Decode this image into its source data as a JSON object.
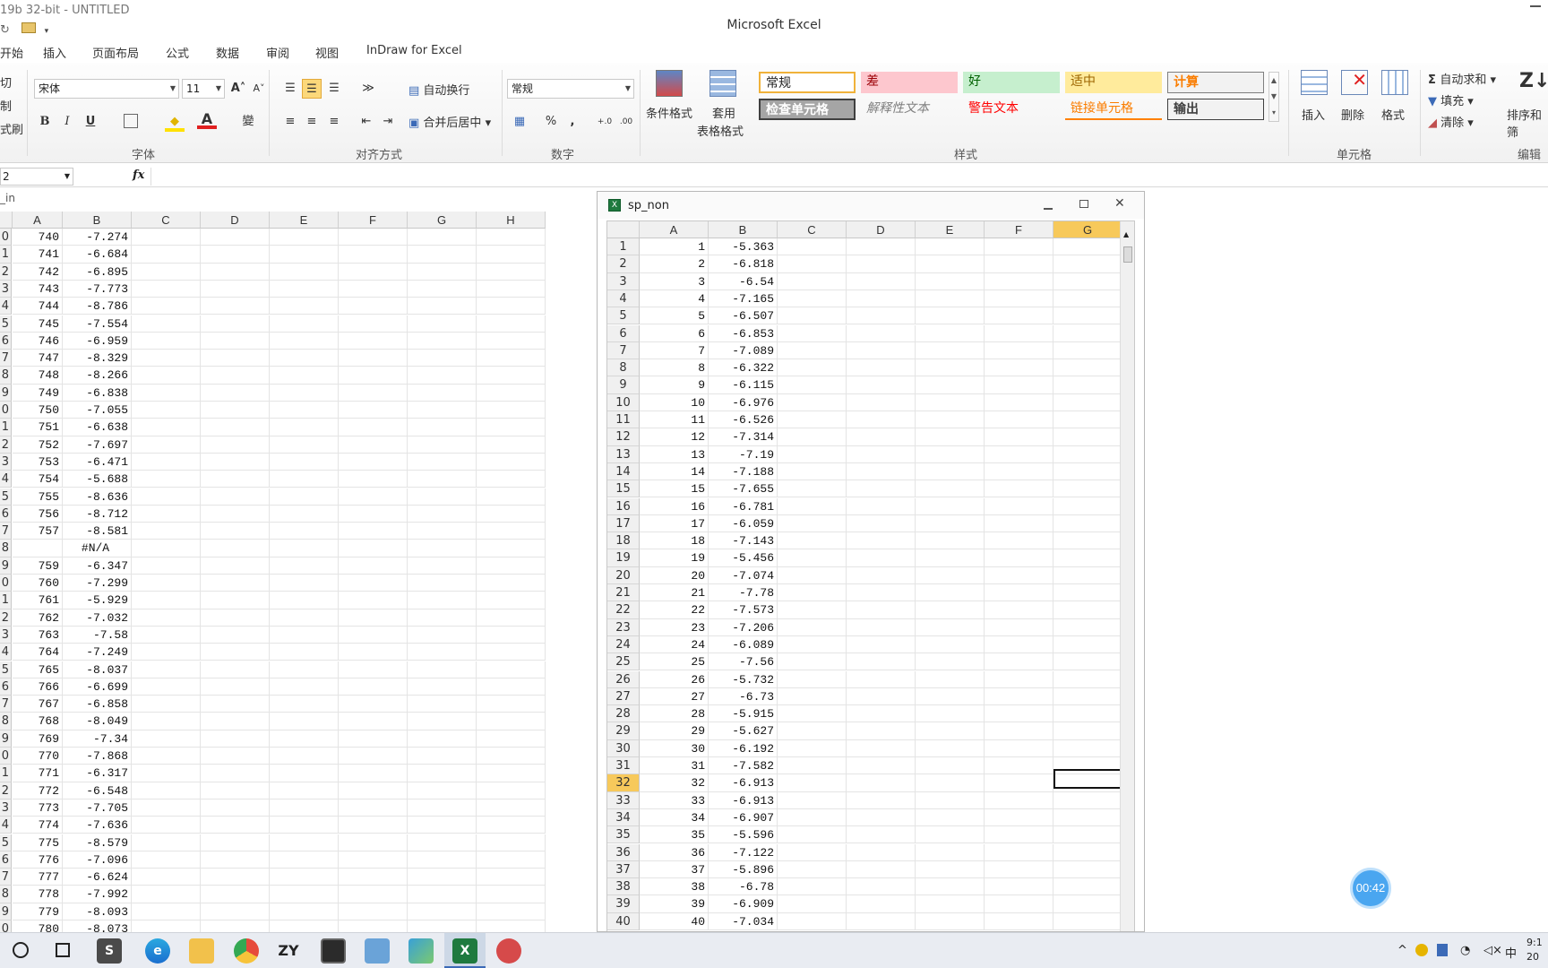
{
  "titlebar": {
    "background_title": "19b 32-bit - UNTITLED",
    "app_title": "Microsoft Excel"
  },
  "tabs": [
    "开始",
    "插入",
    "页面布局",
    "公式",
    "数据",
    "审阅",
    "视图",
    "InDraw for Excel"
  ],
  "ribbon": {
    "clipboard": {
      "cut": "切",
      "copy": "制",
      "format_painter": "式刷"
    },
    "font": {
      "name": "宋体",
      "size": "11",
      "group_label": "字体",
      "bold": "B",
      "italic": "I",
      "underline": "U",
      "grow": "A˄",
      "shrink": "A˅",
      "fill_glyph": "◆",
      "color_glyph": "A",
      "wen": "變"
    },
    "align": {
      "wrap": "自动换行",
      "merge": "合并后居中",
      "group_label": "对齐方式"
    },
    "number": {
      "format": "常规",
      "percent": "%",
      "comma": ",",
      "dec_inc": "+.0 .00",
      "dec_dec": ".00 →.0",
      "group_label": "数字"
    },
    "styles": {
      "cond_format": "条件格式",
      "table_format_1": "套用",
      "table_format_2": "表格格式",
      "group_label": "样式",
      "items": [
        "常规",
        "差",
        "好",
        "适中",
        "计算",
        "检查单元格",
        "解释性文本",
        "警告文本",
        "链接单元格",
        "输出"
      ]
    },
    "cells": {
      "insert": "插入",
      "delete": "删除",
      "format": "格式",
      "group_label": "单元格"
    },
    "editing": {
      "autosum": "自动求和",
      "fill": "填充",
      "clear": "清除",
      "sort": "排序和筛",
      "group_label": "编辑"
    }
  },
  "formula_bar": {
    "name_box": "2",
    "fx": "fx",
    "value": ""
  },
  "left_sheet": {
    "columns": [
      "A",
      "B",
      "C",
      "D",
      "E",
      "F",
      "G",
      "H"
    ],
    "row_suffixes": [
      "0",
      "1",
      "2",
      "3",
      "4",
      "5",
      "6",
      "7",
      "8",
      "9",
      "0",
      "1",
      "2",
      "3",
      "4",
      "5",
      "6",
      "7",
      "8",
      "9",
      "0",
      "1",
      "2",
      "3",
      "4",
      "5",
      "6",
      "7",
      "8",
      "9",
      "0",
      "1",
      "2",
      "3",
      "4",
      "5",
      "6",
      "7",
      "8",
      "9",
      "0"
    ],
    "a": [
      "740",
      "741",
      "742",
      "743",
      "744",
      "745",
      "746",
      "747",
      "748",
      "749",
      "750",
      "751",
      "752",
      "753",
      "754",
      "755",
      "756",
      "757",
      "",
      "759",
      "760",
      "761",
      "762",
      "763",
      "764",
      "765",
      "766",
      "767",
      "768",
      "769",
      "770",
      "771",
      "772",
      "773",
      "774",
      "775",
      "776",
      "777",
      "778",
      "779",
      "780"
    ],
    "b": [
      "-7.274",
      "-6.684",
      "-6.895",
      "-7.773",
      "-8.786",
      "-7.554",
      "-6.959",
      "-8.329",
      "-8.266",
      "-6.838",
      "-7.055",
      "-6.638",
      "-7.697",
      "-6.471",
      "-5.688",
      "-8.636",
      "-8.712",
      "-8.581",
      "#N/A",
      "-6.347",
      "-7.299",
      "-5.929",
      "-7.032",
      "-7.58",
      "-7.249",
      "-8.037",
      "-6.699",
      "-6.858",
      "-8.049",
      "-7.34",
      "-7.868",
      "-6.317",
      "-6.548",
      "-7.705",
      "-7.636",
      "-8.579",
      "-7.096",
      "-6.624",
      "-7.992",
      "-8.093",
      "-8.073"
    ]
  },
  "right_window": {
    "title": "sp_non",
    "columns": [
      "A",
      "B",
      "C",
      "D",
      "E",
      "F",
      "G"
    ],
    "selected_row": "32",
    "selected_col": "G",
    "rows": [
      "1",
      "2",
      "3",
      "4",
      "5",
      "6",
      "7",
      "8",
      "9",
      "10",
      "11",
      "12",
      "13",
      "14",
      "15",
      "16",
      "17",
      "18",
      "19",
      "20",
      "21",
      "22",
      "23",
      "24",
      "25",
      "26",
      "27",
      "28",
      "29",
      "30",
      "31",
      "32",
      "33",
      "34",
      "35",
      "36",
      "37",
      "38",
      "39",
      "40"
    ],
    "b": [
      "-5.363",
      "-6.818",
      "-6.54",
      "-7.165",
      "-6.507",
      "-6.853",
      "-7.089",
      "-6.322",
      "-6.115",
      "-6.976",
      "-6.526",
      "-7.314",
      "-7.19",
      "-7.188",
      "-7.655",
      "-6.781",
      "-6.059",
      "-7.143",
      "-5.456",
      "-7.074",
      "-7.78",
      "-7.573",
      "-7.206",
      "-6.089",
      "-7.56",
      "-5.732",
      "-6.73",
      "-5.915",
      "-5.627",
      "-6.192",
      "-7.582",
      "-6.913",
      "-6.913",
      "-6.907",
      "-5.596",
      "-7.122",
      "-5.896",
      "-6.78",
      "-6.909",
      "-7.034"
    ]
  },
  "taskbar": {
    "zy": "ZY",
    "ime": "中",
    "clock_line1": "9:1",
    "clock_line2": "20"
  },
  "timer": "00:42"
}
